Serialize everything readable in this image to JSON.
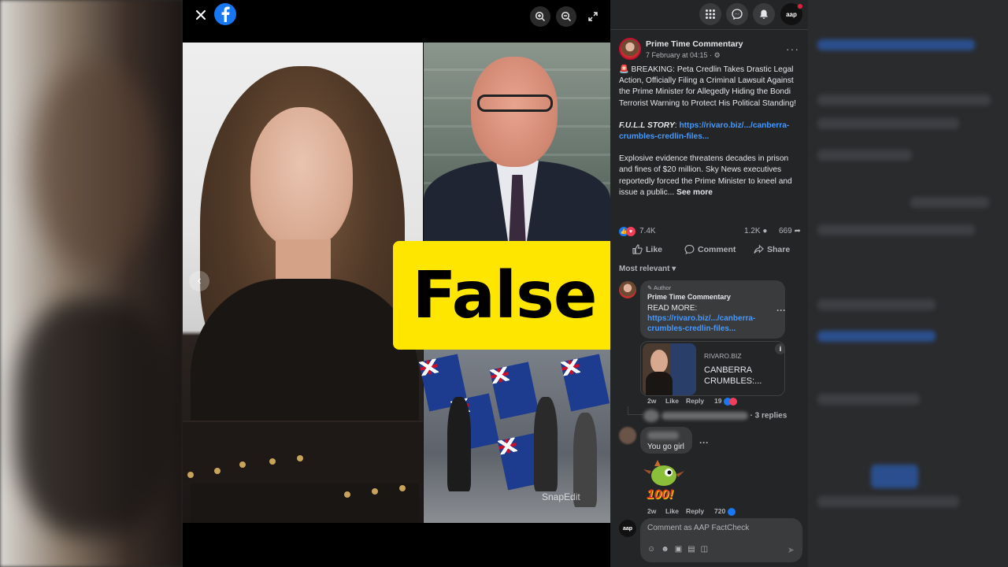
{
  "viewer": {
    "close_icon": "close-icon",
    "logo_icon": "facebook-logo-icon",
    "zoom_in_icon": "zoom-in-icon",
    "zoom_out_icon": "zoom-out-icon",
    "fullscreen_icon": "fullscreen-icon",
    "prev_icon": "chevron-left-icon",
    "watermark": "SnapEdit",
    "verdict_label": "False",
    "verdict_color": "#ffe600"
  },
  "topbar": {
    "menu_icon": "grid-menu-icon",
    "messenger_icon": "messenger-icon",
    "notifications_icon": "bell-icon",
    "account_label": "aap"
  },
  "post": {
    "page_name": "Prime Time Commentary",
    "time": "7 February at 04:15 ·",
    "paragraph1": "🚨 BREAKING: Peta Credlin Takes Drastic Legal Action, Officially Filing a Criminal Lawsuit Against the Prime Minister for Allegedly Hiding the Bondi Terrorist Warning to Protect His Political Standing!",
    "story_label": "F.U.L.L STORY",
    "story_link": "https://rivaro.biz/.../canberra-crumbles-credlin-files...",
    "paragraph3": "Explosive evidence threatens decades in prison and fines of $20 million. Sky News executives reportedly forced the Prime Minister to kneel and issue a public...",
    "see_more": "See more",
    "reaction_count": "7.4K",
    "comment_count": "1.2K",
    "share_count": "669",
    "like_label": "Like",
    "comment_label": "Comment",
    "share_label": "Share",
    "sort_label": "Most relevant"
  },
  "comments": [
    {
      "role": "Author",
      "name": "Prime Time Commentary",
      "text": "READ MORE:",
      "link": "https://rivaro.biz/.../canberra-crumbles-credlin-files...",
      "preview_domain": "RIVARO.BIZ",
      "preview_title": "CANBERRA CRUMBLES:...",
      "age": "2w",
      "like": "Like",
      "reply": "Reply",
      "reactions": "19",
      "replies": "· 3 replies"
    },
    {
      "text": "You go girl",
      "sticker_text": "100!",
      "age": "2w",
      "like": "Like",
      "reply": "Reply",
      "reactions": "720"
    }
  ],
  "composer": {
    "placeholder": "Comment as AAP FactCheck",
    "avatar_label": "aap"
  },
  "colors": {
    "link": "#4599ff",
    "sidebar_bg": "#242526",
    "like_blue": "#1877f2",
    "love_red": "#f33e58"
  }
}
